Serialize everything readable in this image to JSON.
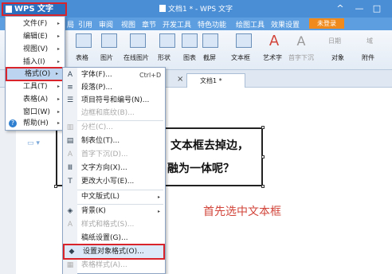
{
  "titlebar": {
    "app_menu_label": "WPS 文字",
    "doc_title": "文档1 * - WPS 文字",
    "min": "^",
    "restore": "—",
    "close": "□"
  },
  "ribbon_tabs": [
    "局",
    "引用",
    "审阅",
    "视图",
    "章节",
    "开发工具",
    "特色功能",
    "绘图工具",
    "效果设置"
  ],
  "login_label": "未登录",
  "toolbar": {
    "table": "表格",
    "picture": "图片",
    "online_picture": "在线图片",
    "shape": "形状",
    "chart": "图表",
    "screenshot": "截屏",
    "textbox": "文本框",
    "wordart": "艺术字",
    "drop_cap": "首字下沉",
    "date": "日期",
    "field": "域",
    "object": "对象",
    "attachment": "附件"
  },
  "doc_tab": "文档1 *",
  "doc_tab_close": "×",
  "main_menu": [
    {
      "label": "文件(F)"
    },
    {
      "label": "编辑(E)"
    },
    {
      "label": "视图(V)"
    },
    {
      "label": "插入(I)"
    },
    {
      "label": "格式(O)"
    },
    {
      "label": "工具(T)"
    },
    {
      "label": "表格(A)"
    },
    {
      "label": "窗口(W)"
    },
    {
      "label": "帮助(H)"
    }
  ],
  "submenu": {
    "font": "字体(F)...",
    "font_shortcut": "Ctrl+D",
    "paragraph": "段落(P)...",
    "bullets": "项目符号和编号(N)...",
    "borders": "边框和底纹(B)...",
    "columns": "分栏(C)...",
    "tabs": "制表位(T)...",
    "drop_cap": "首字下沉(D)...",
    "text_direction": "文字方向(X)...",
    "change_case": "更改大小写(E)...",
    "chinese_layout": "中文版式(L)",
    "background": "背景(K)",
    "styles_formatting": "样式和格式(S)...",
    "paper_setup": "稿纸设置(G)...",
    "set_object_format": "设置对象格式(O)...",
    "table_style": "表格样式(A)..."
  },
  "document": {
    "textbox_line1": "文本框去掉边，",
    "textbox_line2": "融为一体呢？",
    "caption": "首先选中文本框"
  },
  "colors": {
    "title_bar": "#4a8ed6",
    "highlight_red": "#d9242b",
    "caption_red": "#d2443a",
    "login_orange": "#f08a1c"
  }
}
